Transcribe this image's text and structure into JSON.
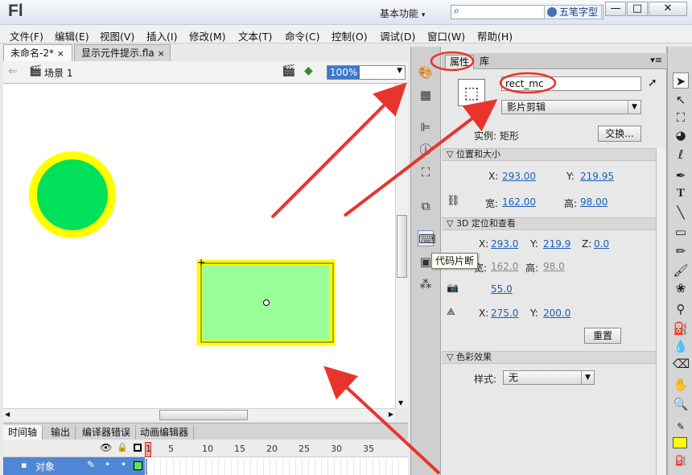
{
  "app": {
    "logo": "Fl",
    "workspace": "基本功能",
    "ime_label": "五笔字型",
    "window_buttons": [
      "—",
      "□",
      "✕"
    ]
  },
  "menu": [
    "文件(F)",
    "编辑(E)",
    "视图(V)",
    "插入(I)",
    "修改(M)",
    "文本(T)",
    "命令(C)",
    "控制(O)",
    "调试(D)",
    "窗口(W)",
    "帮助(H)"
  ],
  "doc_tabs": [
    {
      "label": "未命名-2*",
      "close": "×"
    },
    {
      "label": "显示元件提示.fla",
      "close": "×"
    }
  ],
  "scene": {
    "name": "场景 1",
    "zoom": "100%"
  },
  "bottom_tabs": [
    "时间轴",
    "输出",
    "编译器错误",
    "动画编辑器"
  ],
  "timeline": {
    "frame_numbers": [
      "1",
      "5",
      "10",
      "15",
      "20",
      "25",
      "30",
      "35"
    ],
    "layer_name": "对象"
  },
  "side_icons": [
    "color-palette-icon",
    "swatches-icon",
    "align-icon",
    "info-icon",
    "transform-icon",
    "components-icon",
    "code-snippets-icon",
    "motion-presets-icon",
    "3d-icon"
  ],
  "tooltip": "代码片断",
  "properties": {
    "tabs": [
      "属性",
      "库"
    ],
    "instance_name": "rect_mc",
    "instance_type": "影片剪辑",
    "instance_label": "实例: 矩形",
    "swap_button": "交换...",
    "position_section": "位置和大小",
    "x_label": "X:",
    "x_value": "293.00",
    "y_label": "Y:",
    "y_value": "219.95",
    "w_label": "宽:",
    "w_value": "162.00",
    "h_label": "高:",
    "h_value": "98.00",
    "section_3d": "3D 定位和查看",
    "x3d_value": "293.0",
    "y3d_value": "219.9",
    "z_label": "Z:",
    "z_value": "0.0",
    "w3d_label": "宽:",
    "w3d_value": "162.0",
    "h3d_label": "高:",
    "h3d_value": "98.0",
    "perspective_value": "55.0",
    "vanish_x_value": "275.0",
    "vanish_y_value": "200.0",
    "reset_button": "重置",
    "color_section": "色彩效果",
    "style_label": "样式:",
    "style_value": "无"
  },
  "colors": {
    "circle_fill": "#00e05a",
    "circle_stroke": "#ffff00",
    "rect_fill": "#99ff99",
    "rect_stroke": "#ffff00",
    "annotation": "#e8342c",
    "stroke_color_swatch": "#ffff00"
  }
}
